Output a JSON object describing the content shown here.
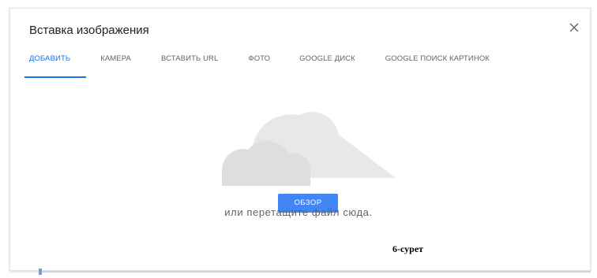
{
  "dialog": {
    "title": "Вставка изображения",
    "close_icon": "close-icon"
  },
  "tabs": [
    {
      "label": "ДОБАВИТЬ",
      "active": true
    },
    {
      "label": "КАМЕРА",
      "active": false
    },
    {
      "label": "ВСТАВИТЬ URL",
      "active": false
    },
    {
      "label": "ФОТО",
      "active": false
    },
    {
      "label": "GOOGLE ДИСК",
      "active": false
    },
    {
      "label": "GOOGLE ПОИСК КАРТИНОК",
      "active": false
    }
  ],
  "upload": {
    "illustration_icon": "cloud-icon",
    "browse_label": "ОБЗОР",
    "hint": "или перетащите файл сюда."
  },
  "caption": "6-сурет",
  "colors": {
    "accent": "#1a73e8",
    "button": "#4285f4",
    "cloud": "#dadce0"
  }
}
